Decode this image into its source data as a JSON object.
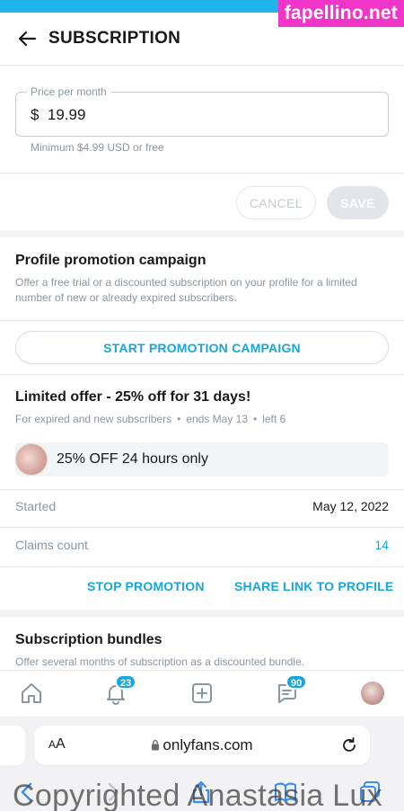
{
  "watermark": {
    "site": "fapellino.net",
    "copyright": "Copyrighted Anastasia Lux"
  },
  "header": {
    "title": "SUBSCRIPTION"
  },
  "price": {
    "label": "Price per month",
    "value": "$  19.99",
    "hint": "Minimum $4.99 USD or free"
  },
  "actions": {
    "cancel": "CANCEL",
    "save": "SAVE"
  },
  "promotion": {
    "title": "Profile promotion campaign",
    "description": "Offer a free trial or a discounted subscription on your profile for a limited number of new or already expired subscribers.",
    "start_button": "START PROMOTION CAMPAIGN"
  },
  "offer": {
    "title": "Limited offer - 25% off for 31 days!",
    "meta_audience": "For expired and new subscribers",
    "meta_ends": "ends May 13",
    "meta_left": "left 6",
    "chip_text": "25% OFF 24 hours only",
    "started_label": "Started",
    "started_value": "May 12, 2022",
    "claims_label": "Claims count",
    "claims_value": "14",
    "stop_label": "STOP PROMOTION",
    "share_label": "SHARE LINK TO PROFILE"
  },
  "bundles": {
    "title": "Subscription bundles",
    "description": "Offer several months of subscription as a discounted bundle."
  },
  "nav": {
    "notifications_badge": "23",
    "messages_badge": "90"
  },
  "browser": {
    "aa": "AA",
    "url": "onlyfans.com"
  },
  "colors": {
    "accent": "#17a6dc",
    "top_bar": "#20b4ea",
    "watermark_bg": "#f035c8"
  }
}
